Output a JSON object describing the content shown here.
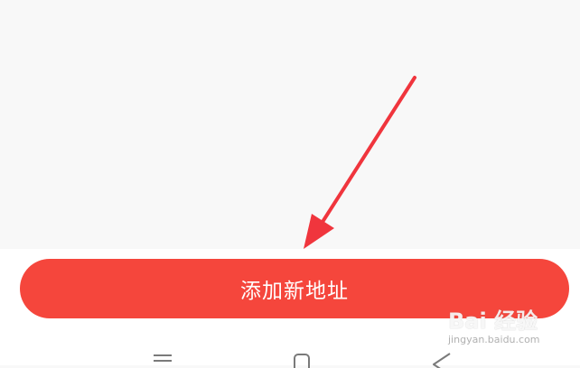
{
  "main": {
    "add_address_label": "添加新地址"
  },
  "annotation": {
    "arrow_color": "#f0353d"
  },
  "watermark": {
    "logo": "Bai  经验",
    "url": "jingyan.baidu.com"
  },
  "colors": {
    "primary_button": "#f5463c",
    "background": "#f8f8f8"
  },
  "nav": {
    "icons": [
      "menu-icon",
      "home-icon",
      "back-icon"
    ]
  }
}
